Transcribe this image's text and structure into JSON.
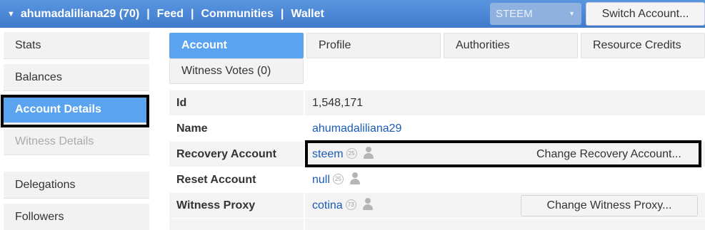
{
  "topbar": {
    "account": "ahumadaliliana29 (70)",
    "sep": "|",
    "nav": [
      "Feed",
      "Communities",
      "Wallet"
    ],
    "chain_select": "STEEM",
    "switch_account": "Switch Account..."
  },
  "sidebar": {
    "items": [
      "Stats",
      "Balances",
      "Account Details",
      "Witness Details",
      "Delegations",
      "Followers"
    ]
  },
  "tabs": [
    "Account",
    "Profile",
    "Authorities",
    "Resource Credits",
    "Witness Votes (0)"
  ],
  "details": {
    "id": {
      "label": "Id",
      "value": "1,548,171"
    },
    "name": {
      "label": "Name",
      "value": "ahumadaliliana29"
    },
    "recovery": {
      "label": "Recovery Account",
      "value": "steem",
      "rep": "25",
      "button": "Change Recovery Account..."
    },
    "reset": {
      "label": "Reset Account",
      "value": "null",
      "rep": "25"
    },
    "proxy": {
      "label": "Witness Proxy",
      "value": "cotina",
      "rep": "73",
      "button": "Change Witness Proxy..."
    }
  },
  "colors": {
    "accent": "#5aa3f0",
    "topbar": "#4a86d4",
    "link": "#1a5bb8"
  },
  "icons": [
    "caret-down-icon",
    "select-arrow-icon",
    "person-icon"
  ]
}
